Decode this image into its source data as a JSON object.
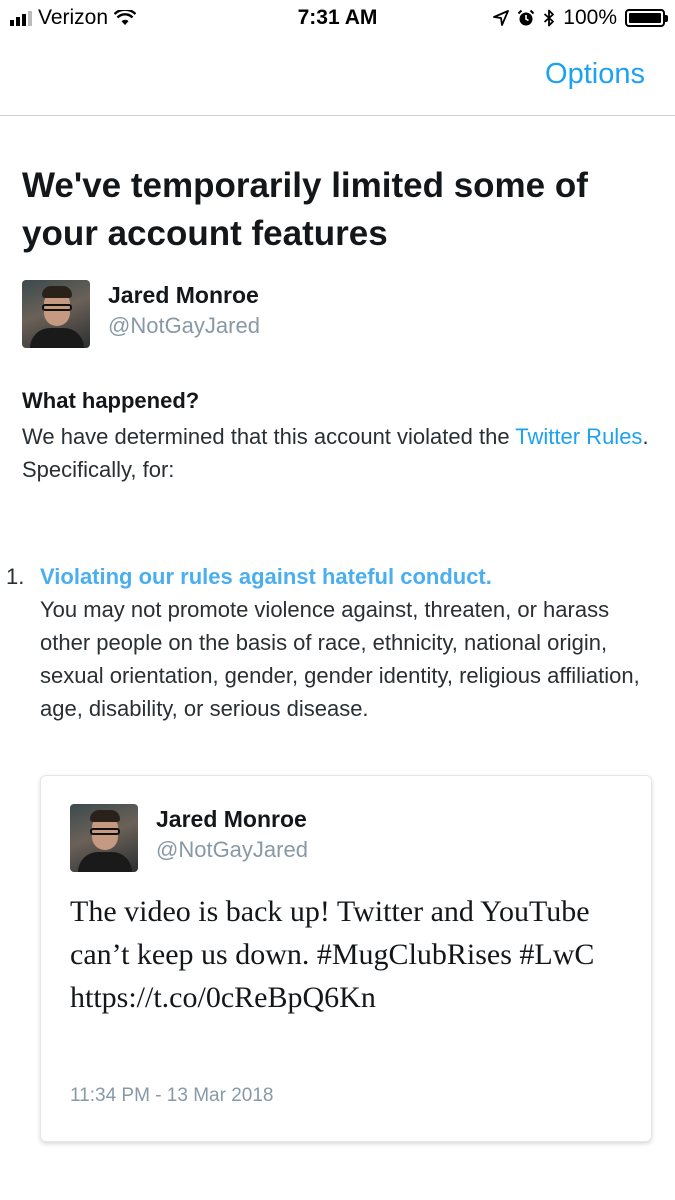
{
  "status_bar": {
    "carrier": "Verizon",
    "time": "7:31 AM",
    "battery": "100%",
    "icons": [
      "signal-icon",
      "wifi-icon",
      "location-icon",
      "alarm-icon",
      "bluetooth-icon",
      "battery-icon"
    ]
  },
  "nav": {
    "options_label": "Options"
  },
  "notice": {
    "title": "We've temporarily limited some of your account features",
    "account": {
      "name": "Jared Monroe",
      "handle": "@NotGayJared"
    },
    "what_happened_heading": "What happened?",
    "explanation_prefix": "We have determined that this account violated the ",
    "rules_link": "Twitter Rules",
    "explanation_suffix": ". Specifically, for:"
  },
  "violations": [
    {
      "number": "1.",
      "title": "Violating our rules against hateful conduct.",
      "description": "You may not promote violence against, threaten, or harass other people on the basis of race, ethnicity, national origin, sexual orientation, gender, gender identity, religious affiliation, age, disability, or serious disease."
    }
  ],
  "tweet": {
    "author_name": "Jared Monroe",
    "author_handle": "@NotGayJared",
    "text": "The video is back up! Twitter and YouTube can’t keep us down. #MugClubRises #LwC https://t.co/0cReBpQ6Kn",
    "timestamp": "11:34 PM - 13 Mar 2018"
  },
  "colors": {
    "link": "#1da1f2",
    "violation_link": "#4aaef0",
    "secondary_text": "#8899a6",
    "primary_text": "#14171a"
  }
}
